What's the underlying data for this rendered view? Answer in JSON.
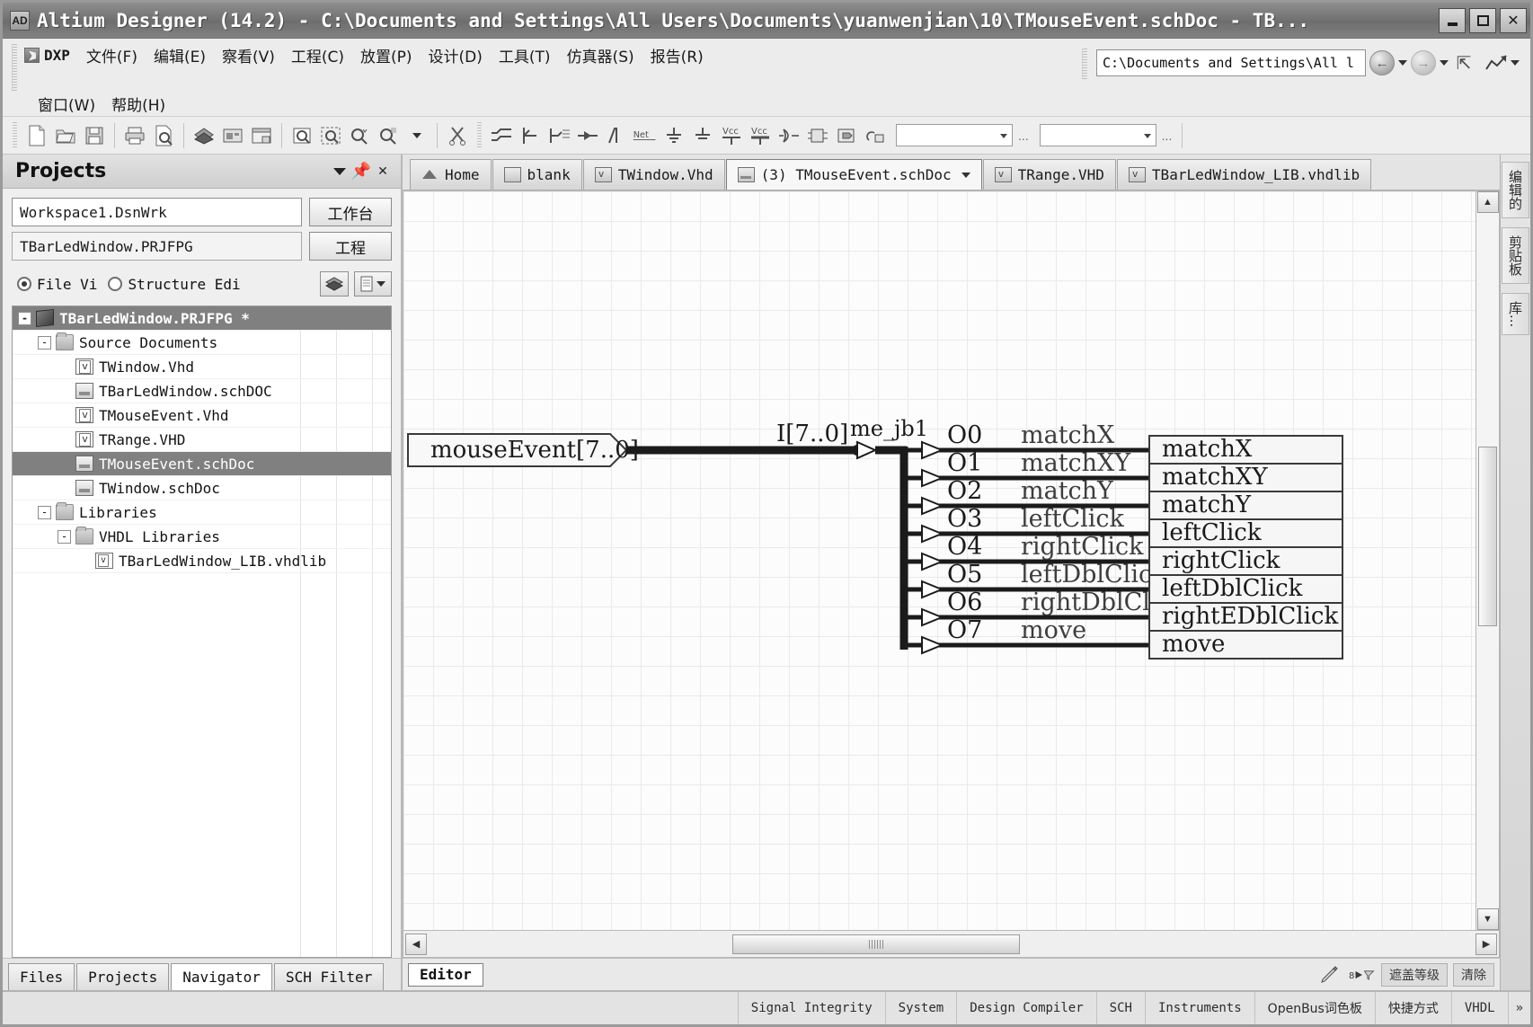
{
  "window": {
    "title": "Altium Designer (14.2) - C:\\Documents and Settings\\All Users\\Documents\\yuanwenjian\\10\\TMouseEvent.schDoc - TB...",
    "app_icon": "AD",
    "minimize": "minimize-icon",
    "maximize": "maximize-icon",
    "close": "✕"
  },
  "menu": {
    "dxp_label": "DXP",
    "items": [
      "文件(F)",
      "编辑(E)",
      "察看(V)",
      "工程(C)",
      "放置(P)",
      "设计(D)",
      "工具(T)",
      "仿真器(S)",
      "报告(R)"
    ],
    "items_row2": [
      "窗口(W)",
      "帮助(H)"
    ],
    "address_value": "C:\\Documents and Settings\\All l",
    "back_icon": "back-arrow-icon",
    "forward_icon": "forward-arrow-icon",
    "up_icon": "up-arrow-icon",
    "chart_icon": "chart-icon"
  },
  "toolbar": {
    "group1": [
      "new-document-icon",
      "open-folder-icon",
      "save-icon"
    ],
    "group2": [
      "print-icon",
      "print-preview-icon"
    ],
    "group3": [
      "open-project-icon",
      "pcb-view-icon",
      "window-tile-icon"
    ],
    "group4": [
      "zoom-document-icon",
      "zoom-area-icon",
      "zoom-in-icon",
      "zoom-select-icon"
    ],
    "group5": [
      "cut-icon"
    ],
    "group6": [
      "wire-icon",
      "bus-icon",
      "bus-entry-icon",
      "net-node-icon",
      "port-icon",
      "net-label-icon",
      "gnd-power-icon",
      "gnd-signal-icon",
      "vcc-power-icon",
      "vcc-bar-icon",
      "logic-gate-icon",
      "sheet-symbol-icon",
      "sheet-entry-icon",
      "device-icon"
    ],
    "combo1": "",
    "combo2": "",
    "ellipsis": "..."
  },
  "projects_panel": {
    "title": "Projects",
    "collapse_icon": "chevron-down-icon",
    "pin_icon": "pin-icon",
    "close_icon": "close-icon",
    "workspace_value": "Workspace1.DsnWrk",
    "workspace_button": "工作台",
    "project_value": "TBarLedWindow.PRJFPG",
    "project_button": "工程",
    "view_mode": {
      "file_view_label": "File Vi",
      "file_view_selected": true,
      "structure_edit_label": "Structure Edi",
      "structure_edit_selected": false
    },
    "tool_icons": [
      "project-compile-icon",
      "document-options-icon"
    ],
    "tree": [
      {
        "depth": 0,
        "label": "TBarLedWindow.PRJFPG *",
        "icon": "project-icon",
        "expander": "-",
        "selected": true,
        "bold": true
      },
      {
        "depth": 1,
        "label": "Source Documents",
        "icon": "folder-icon",
        "expander": "-",
        "selected": false,
        "bold": false
      },
      {
        "depth": 2,
        "label": "TWindow.Vhd",
        "icon": "vhd-file-icon",
        "expander": "",
        "selected": false,
        "bold": false
      },
      {
        "depth": 2,
        "label": "TBarLedWindow.schDOC",
        "icon": "sch-file-icon",
        "expander": "",
        "selected": false,
        "bold": false
      },
      {
        "depth": 2,
        "label": "TMouseEvent.Vhd",
        "icon": "vhd-file-icon",
        "expander": "",
        "selected": false,
        "bold": false
      },
      {
        "depth": 2,
        "label": "TRange.VHD",
        "icon": "vhd-file-icon",
        "expander": "",
        "selected": false,
        "bold": false
      },
      {
        "depth": 2,
        "label": "TMouseEvent.schDoc",
        "icon": "sch-file-icon",
        "expander": "",
        "selected": true,
        "bold": false
      },
      {
        "depth": 2,
        "label": "TWindow.schDoc",
        "icon": "sch-file-icon",
        "expander": "",
        "selected": false,
        "bold": false
      },
      {
        "depth": 1,
        "label": "Libraries",
        "icon": "folder-icon",
        "expander": "-",
        "selected": false,
        "bold": false
      },
      {
        "depth": 2,
        "label": "VHDL Libraries",
        "icon": "folder-icon",
        "expander": "-",
        "selected": false,
        "bold": false
      },
      {
        "depth": 3,
        "label": "TBarLedWindow_LIB.vhdlib",
        "icon": "vhdlib-file-icon",
        "expander": "",
        "selected": false,
        "bold": false
      }
    ],
    "bottom_tabs": [
      {
        "label": "Files",
        "active": false
      },
      {
        "label": "Projects",
        "active": false
      },
      {
        "label": "Navigator",
        "active": true
      },
      {
        "label": "SCH Filter",
        "active": false
      }
    ]
  },
  "document_tabs": [
    {
      "label": "Home",
      "icon": "home-icon",
      "active": false,
      "has_caret": false
    },
    {
      "label": "blank",
      "icon": "blank-doc-icon",
      "active": false,
      "has_caret": false
    },
    {
      "label": "TWindow.Vhd",
      "icon": "vhd-file-icon",
      "active": false,
      "has_caret": false
    },
    {
      "label": "(3) TMouseEvent.schDoc",
      "icon": "sch-file-icon",
      "active": true,
      "has_caret": true
    },
    {
      "label": "TRange.VHD",
      "icon": "vhd-file-icon",
      "active": false,
      "has_caret": false
    },
    {
      "label": "TBarLedWindow_LIB.vhdlib",
      "icon": "vhdlib-file-icon",
      "active": false,
      "has_caret": false
    }
  ],
  "schematic": {
    "input_port_label": "mouseEvent[7..0]",
    "bus_net_label": "I[7..0]",
    "component_designator": "me_jb1",
    "pins": [
      {
        "name": "O0",
        "net": "matchX"
      },
      {
        "name": "O1",
        "net": "matchXY"
      },
      {
        "name": "O2",
        "net": "matchY"
      },
      {
        "name": "O3",
        "net": "leftClick"
      },
      {
        "name": "O4",
        "net": "rightClick"
      },
      {
        "name": "O5",
        "net": "leftDblClick"
      },
      {
        "name": "O6",
        "net": "rightDblClick"
      },
      {
        "name": "O7",
        "net": "move"
      }
    ],
    "output_ports": [
      "matchX",
      "matchXY",
      "matchY",
      "leftClick",
      "rightClick",
      "leftDblClick",
      "rightEDblClick",
      "move"
    ]
  },
  "editor_status": {
    "editor_tab": "Editor",
    "pen_icon": "pen-icon",
    "mask_icon": "mask-level-icon",
    "mask_label": "遮盖等级",
    "clear_label": "清除"
  },
  "right_dock": {
    "tabs": [
      "编辑的",
      "剪贴板",
      "库..."
    ]
  },
  "status_bar": {
    "cells": [
      "Signal Integrity",
      "System",
      "Design Compiler",
      "SCH",
      "Instruments",
      "OpenBus词色板",
      "快捷方式",
      "VHDL"
    ],
    "more": "»"
  }
}
